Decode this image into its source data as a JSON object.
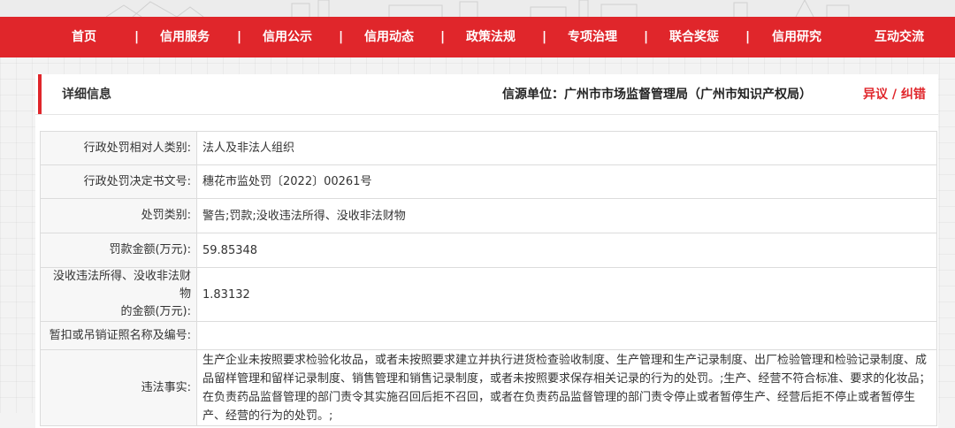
{
  "nav": {
    "items": [
      "首页",
      "信用服务",
      "信用公示",
      "信用动态",
      "政策法规",
      "专项治理",
      "联合奖惩",
      "信用研究",
      "互动交流"
    ],
    "separator": "|"
  },
  "colors": {
    "brand_red": "#e0262b"
  },
  "header": {
    "title": "详细信息",
    "source": "信源单位：广州市市场监督管理局（广州市知识产权局）",
    "dispute": "异议 / 纠错"
  },
  "rows": [
    {
      "label": "行政处罚相对人类别:",
      "value": "法人及非法人组织"
    },
    {
      "label": "行政处罚决定书文号:",
      "value": "穗花市监处罚〔2022〕00261号"
    },
    {
      "label": "处罚类别:",
      "value": "警告;罚款;没收违法所得、没收非法财物"
    },
    {
      "label": "罚款金额(万元):",
      "value": "59.85348"
    },
    {
      "label_line1": "没收违法所得、没收非法财物",
      "label_line2": "的金额(万元):",
      "value": "1.83132"
    },
    {
      "label": "暂扣或吊销证照名称及编号:",
      "value": ""
    },
    {
      "label": "违法事实:",
      "value": "生产企业未按照要求检验化妆品，或者未按照要求建立并执行进货检查验收制度、生产管理和生产记录制度、出厂检验管理和检验记录制度、成品留样管理和留样记录制度、销售管理和销售记录制度，或者未按照要求保存相关记录的行为的处罚。;生产、经营不符合标准、要求的化妆品；在负责药品监督管理的部门责令其实施召回后拒不召回，或者在负责药品监督管理的部门责令停止或者暂停生产、经营后拒不停止或者暂停生产、经营的行为的处罚。;"
    }
  ]
}
